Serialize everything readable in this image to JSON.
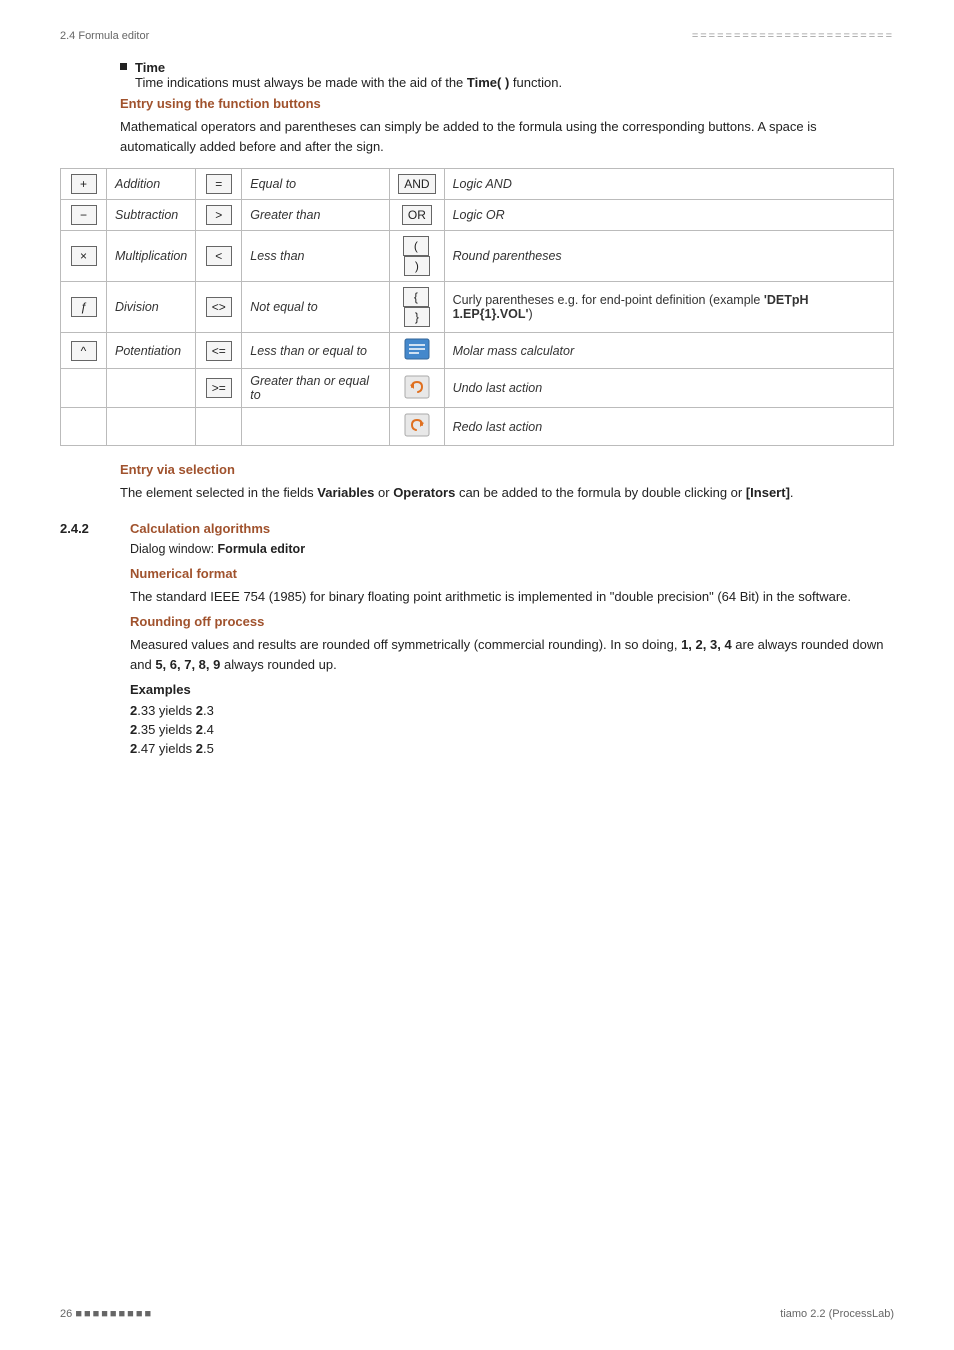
{
  "header": {
    "left": "2.4 Formula editor",
    "right_dots": "========================"
  },
  "time_section": {
    "bullet_label": "Time",
    "bullet_desc": "Time indications must always be made with the aid of the ",
    "bullet_func": "Time( )",
    "bullet_suffix": " function."
  },
  "entry_buttons": {
    "title": "Entry using the function buttons",
    "intro": "Mathematical operators and parentheses can simply be added to the formula using the corresponding buttons. A space is automatically added before and after the sign."
  },
  "table_rows": [
    {
      "btn1": "+",
      "label1": "Addition",
      "btn2": "=",
      "label2": "Equal to",
      "btn3": "AND",
      "label3": "Logic AND"
    },
    {
      "btn1": "−",
      "label1": "Subtraction",
      "btn2": ">",
      "label2": "Greater than",
      "btn3": "OR",
      "label3": "Logic OR"
    },
    {
      "btn1": "×",
      "label1": "Multiplication",
      "btn2": "<",
      "label2": "Less than",
      "btn3": "( )",
      "label3": "Round parentheses"
    },
    {
      "btn1": "ƒ",
      "label1": "Division",
      "btn2": "<>",
      "label2": "Not equal to",
      "btn3": "{ }",
      "label3": "Curly parentheses e.g. for end-point definition (example 'DETpH 1.EP{1}.VOL')"
    },
    {
      "btn1": "^",
      "label1": "Potentiation",
      "btn2": "<=",
      "label2": "Less than or equal to",
      "btn3": "molar",
      "label3": "Molar mass calculator"
    },
    {
      "btn1": "",
      "label1": "",
      "btn2": ">=",
      "label2": "Greater than or equal to",
      "btn3": "undo",
      "label3": "Undo last action"
    },
    {
      "btn1": "",
      "label1": "",
      "btn2": "",
      "label2": "",
      "btn3": "redo",
      "label3": "Redo last action"
    }
  ],
  "entry_selection": {
    "title": "Entry via selection",
    "text1": "The element selected in the fields ",
    "bold1": "Variables",
    "text2": " or ",
    "bold2": "Operators",
    "text3": " can be added to the formula by double clicking or ",
    "bold3": "[Insert]",
    "text4": "."
  },
  "section242": {
    "number": "2.4.2",
    "title": "Calculation algorithms",
    "dialog_note": "Dialog window: ",
    "dialog_bold": "Formula editor"
  },
  "numerical_format": {
    "title": "Numerical format",
    "text": "The standard IEEE 754 (1985) for binary floating point arithmetic is implemented in \"double precision\" (64 Bit) in the software."
  },
  "rounding": {
    "title": "Rounding off process",
    "text1": "Measured values and results are rounded off symmetrically (commercial rounding). In so doing, ",
    "bold1": "1, 2, 3, 4",
    "text2": " are always rounded down and ",
    "bold2": "5, 6, 7, 8, 9",
    "text3": " always rounded up."
  },
  "examples": {
    "title": "Examples",
    "items": [
      {
        "prefix": "2",
        "bold": ".33",
        "suffix": " yields ",
        "result_bold": "2",
        "result_suffix": ".3"
      },
      {
        "prefix": "2",
        "bold": ".35",
        "suffix": " yields ",
        "result_bold": "2",
        "result_suffix": ".4"
      },
      {
        "prefix": "2",
        "bold": ".47",
        "suffix": " yields ",
        "result_bold": "2",
        "result_suffix": ".5"
      }
    ]
  },
  "footer": {
    "page": "26",
    "dots": "■■■■■■■■■",
    "brand": "tiamo 2.2 (ProcessLab)"
  }
}
